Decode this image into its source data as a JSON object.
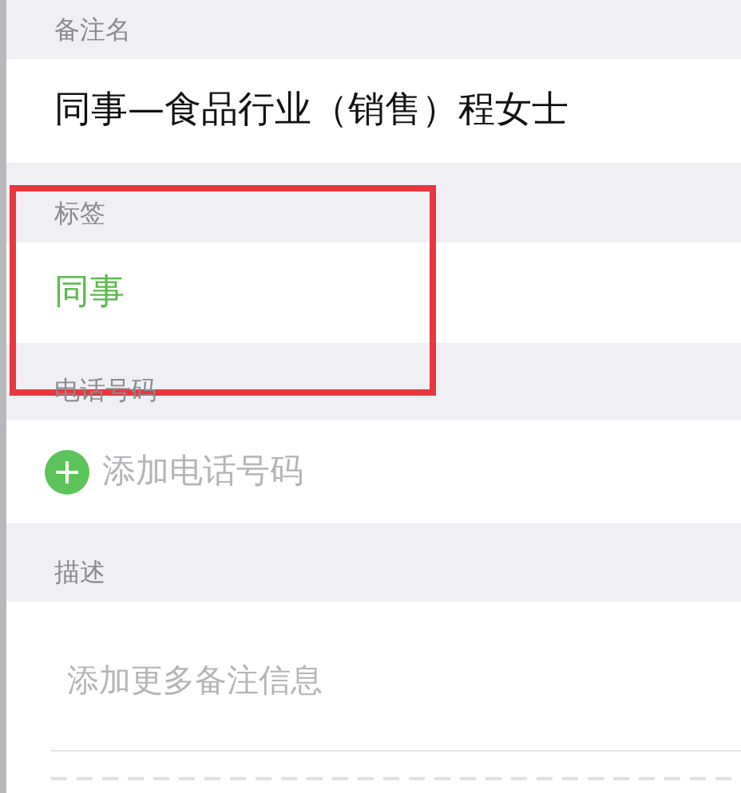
{
  "sections": [
    {
      "header": "备注名",
      "kind": "text",
      "value": "同事—食品行业（销售）程女士"
    },
    {
      "header": "标签",
      "kind": "tag",
      "value": "同事",
      "highlighted": true
    },
    {
      "header": "电话号码",
      "kind": "add",
      "placeholder": "添加电话号码"
    },
    {
      "header": "描述",
      "kind": "textarea",
      "placeholder": "添加更多备注信息"
    }
  ]
}
